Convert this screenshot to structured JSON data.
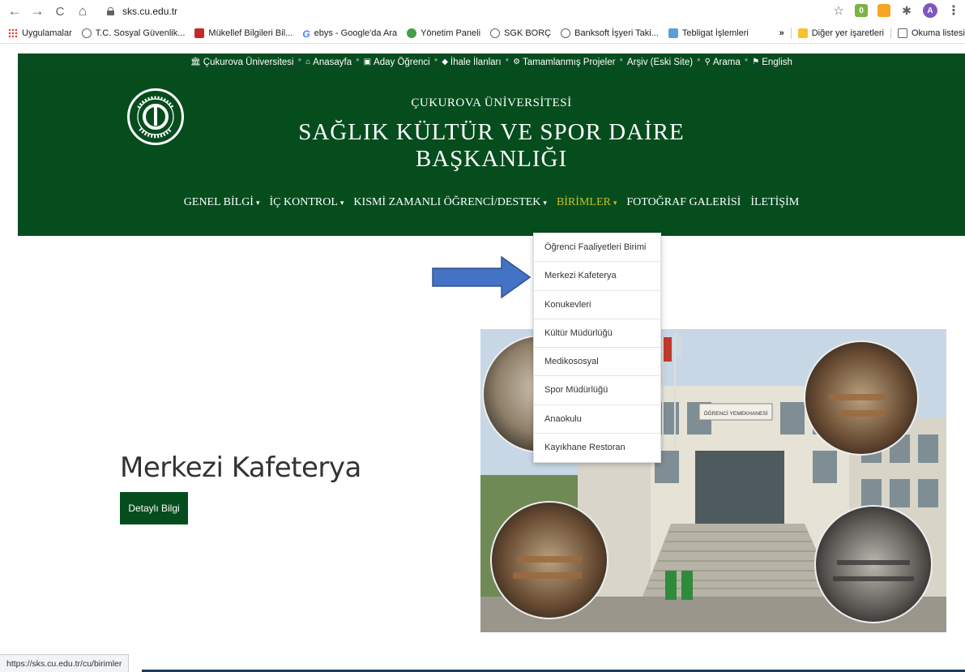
{
  "browser": {
    "url": "sks.cu.edu.tr",
    "back_icon": "←",
    "forward_icon": "→",
    "reload_icon": "C",
    "home_icon": "⌂",
    "star_icon": "☆",
    "ext_badge": "0",
    "avatar_letter": "A",
    "menu_icon": "⋮",
    "puzzle_icon": "✱"
  },
  "bookmarks": {
    "items": [
      "Uygulamalar",
      "T.C. Sosyal Güvenlik...",
      "Mükellef Bilgileri Bil...",
      "ebys - Google'da Ara",
      "Yönetim Paneli",
      "SGK BORÇ",
      "Banksoft İşyeri Taki...",
      "Tebligat İşlemleri"
    ],
    "more": "»",
    "other": "Diğer yer işaretleri",
    "reading_list": "Okuma listesi"
  },
  "top_links": {
    "items": [
      "Çukurova Üniversitesi",
      "Anasayfa",
      "Aday Öğrenci",
      "İhale İlanları",
      "Tamamlanmış Projeler",
      "Arşiv (Eski Site)",
      "Arama",
      "English"
    ],
    "separator": "*"
  },
  "header": {
    "subtitle": "ÇUKUROVA ÜNİVERSİTESİ",
    "title_line1": "SAĞLIK KÜLTÜR VE SPOR DAİRE",
    "title_line2": "BAŞKANLIĞI",
    "logo_ring_text": "ÇUKUROVA ÜNİVERSİTESİ",
    "logo_year": "1973"
  },
  "main_nav": {
    "items": [
      "GENEL BİLGİ",
      "İÇ KONTROL",
      "KISMİ ZAMANLI ÖĞRENCİ/DESTEK",
      "BİRİMLER",
      "FOTOĞRAF GALERİSİ",
      "İLETİŞİM"
    ],
    "caret": "▾",
    "active_color": "#c8c024"
  },
  "dropdown": {
    "items": [
      "Öğrenci Faaliyetleri Birimi",
      "Merkezi Kafeterya",
      "Konukevleri",
      "Kültür Müdürlüğü",
      "Medikososyal",
      "Spor Müdürlüğü",
      "Anaokulu",
      "Kayıkhane Restoran"
    ]
  },
  "hero": {
    "title": "Merkezi Kafeterya",
    "button": "Detaylı Bilgi",
    "sign_text": "ÖĞRENCİ YEMEKHANESİ"
  },
  "status_bar": {
    "url": "https://sks.cu.edu.tr/cu/birimler"
  },
  "colors": {
    "brand_green": "#064d1e",
    "arrow_blue": "#4472c4",
    "arrow_border": "#2f528f"
  }
}
